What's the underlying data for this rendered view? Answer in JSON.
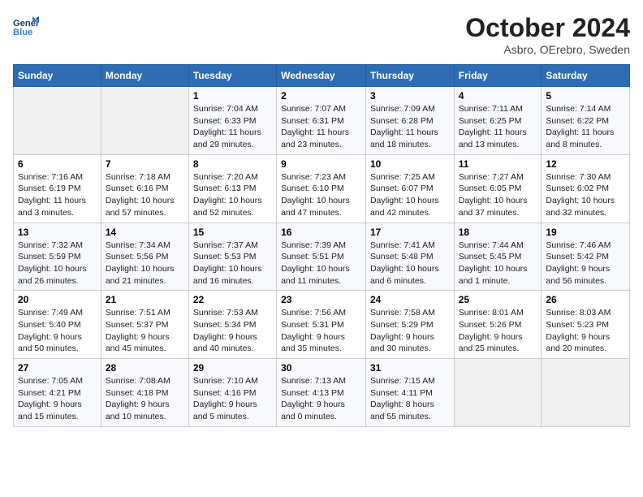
{
  "header": {
    "logo_line1": "General",
    "logo_line2": "Blue",
    "month_title": "October 2024",
    "location": "Asbro, OErebro, Sweden"
  },
  "weekdays": [
    "Sunday",
    "Monday",
    "Tuesday",
    "Wednesday",
    "Thursday",
    "Friday",
    "Saturday"
  ],
  "weeks": [
    [
      {
        "day": "",
        "sunrise": "",
        "sunset": "",
        "daylight": ""
      },
      {
        "day": "",
        "sunrise": "",
        "sunset": "",
        "daylight": ""
      },
      {
        "day": "1",
        "sunrise": "Sunrise: 7:04 AM",
        "sunset": "Sunset: 6:33 PM",
        "daylight": "Daylight: 11 hours and 29 minutes."
      },
      {
        "day": "2",
        "sunrise": "Sunrise: 7:07 AM",
        "sunset": "Sunset: 6:31 PM",
        "daylight": "Daylight: 11 hours and 23 minutes."
      },
      {
        "day": "3",
        "sunrise": "Sunrise: 7:09 AM",
        "sunset": "Sunset: 6:28 PM",
        "daylight": "Daylight: 11 hours and 18 minutes."
      },
      {
        "day": "4",
        "sunrise": "Sunrise: 7:11 AM",
        "sunset": "Sunset: 6:25 PM",
        "daylight": "Daylight: 11 hours and 13 minutes."
      },
      {
        "day": "5",
        "sunrise": "Sunrise: 7:14 AM",
        "sunset": "Sunset: 6:22 PM",
        "daylight": "Daylight: 11 hours and 8 minutes."
      }
    ],
    [
      {
        "day": "6",
        "sunrise": "Sunrise: 7:16 AM",
        "sunset": "Sunset: 6:19 PM",
        "daylight": "Daylight: 11 hours and 3 minutes."
      },
      {
        "day": "7",
        "sunrise": "Sunrise: 7:18 AM",
        "sunset": "Sunset: 6:16 PM",
        "daylight": "Daylight: 10 hours and 57 minutes."
      },
      {
        "day": "8",
        "sunrise": "Sunrise: 7:20 AM",
        "sunset": "Sunset: 6:13 PM",
        "daylight": "Daylight: 10 hours and 52 minutes."
      },
      {
        "day": "9",
        "sunrise": "Sunrise: 7:23 AM",
        "sunset": "Sunset: 6:10 PM",
        "daylight": "Daylight: 10 hours and 47 minutes."
      },
      {
        "day": "10",
        "sunrise": "Sunrise: 7:25 AM",
        "sunset": "Sunset: 6:07 PM",
        "daylight": "Daylight: 10 hours and 42 minutes."
      },
      {
        "day": "11",
        "sunrise": "Sunrise: 7:27 AM",
        "sunset": "Sunset: 6:05 PM",
        "daylight": "Daylight: 10 hours and 37 minutes."
      },
      {
        "day": "12",
        "sunrise": "Sunrise: 7:30 AM",
        "sunset": "Sunset: 6:02 PM",
        "daylight": "Daylight: 10 hours and 32 minutes."
      }
    ],
    [
      {
        "day": "13",
        "sunrise": "Sunrise: 7:32 AM",
        "sunset": "Sunset: 5:59 PM",
        "daylight": "Daylight: 10 hours and 26 minutes."
      },
      {
        "day": "14",
        "sunrise": "Sunrise: 7:34 AM",
        "sunset": "Sunset: 5:56 PM",
        "daylight": "Daylight: 10 hours and 21 minutes."
      },
      {
        "day": "15",
        "sunrise": "Sunrise: 7:37 AM",
        "sunset": "Sunset: 5:53 PM",
        "daylight": "Daylight: 10 hours and 16 minutes."
      },
      {
        "day": "16",
        "sunrise": "Sunrise: 7:39 AM",
        "sunset": "Sunset: 5:51 PM",
        "daylight": "Daylight: 10 hours and 11 minutes."
      },
      {
        "day": "17",
        "sunrise": "Sunrise: 7:41 AM",
        "sunset": "Sunset: 5:48 PM",
        "daylight": "Daylight: 10 hours and 6 minutes."
      },
      {
        "day": "18",
        "sunrise": "Sunrise: 7:44 AM",
        "sunset": "Sunset: 5:45 PM",
        "daylight": "Daylight: 10 hours and 1 minute."
      },
      {
        "day": "19",
        "sunrise": "Sunrise: 7:46 AM",
        "sunset": "Sunset: 5:42 PM",
        "daylight": "Daylight: 9 hours and 56 minutes."
      }
    ],
    [
      {
        "day": "20",
        "sunrise": "Sunrise: 7:49 AM",
        "sunset": "Sunset: 5:40 PM",
        "daylight": "Daylight: 9 hours and 50 minutes."
      },
      {
        "day": "21",
        "sunrise": "Sunrise: 7:51 AM",
        "sunset": "Sunset: 5:37 PM",
        "daylight": "Daylight: 9 hours and 45 minutes."
      },
      {
        "day": "22",
        "sunrise": "Sunrise: 7:53 AM",
        "sunset": "Sunset: 5:34 PM",
        "daylight": "Daylight: 9 hours and 40 minutes."
      },
      {
        "day": "23",
        "sunrise": "Sunrise: 7:56 AM",
        "sunset": "Sunset: 5:31 PM",
        "daylight": "Daylight: 9 hours and 35 minutes."
      },
      {
        "day": "24",
        "sunrise": "Sunrise: 7:58 AM",
        "sunset": "Sunset: 5:29 PM",
        "daylight": "Daylight: 9 hours and 30 minutes."
      },
      {
        "day": "25",
        "sunrise": "Sunrise: 8:01 AM",
        "sunset": "Sunset: 5:26 PM",
        "daylight": "Daylight: 9 hours and 25 minutes."
      },
      {
        "day": "26",
        "sunrise": "Sunrise: 8:03 AM",
        "sunset": "Sunset: 5:23 PM",
        "daylight": "Daylight: 9 hours and 20 minutes."
      }
    ],
    [
      {
        "day": "27",
        "sunrise": "Sunrise: 7:05 AM",
        "sunset": "Sunset: 4:21 PM",
        "daylight": "Daylight: 9 hours and 15 minutes."
      },
      {
        "day": "28",
        "sunrise": "Sunrise: 7:08 AM",
        "sunset": "Sunset: 4:18 PM",
        "daylight": "Daylight: 9 hours and 10 minutes."
      },
      {
        "day": "29",
        "sunrise": "Sunrise: 7:10 AM",
        "sunset": "Sunset: 4:16 PM",
        "daylight": "Daylight: 9 hours and 5 minutes."
      },
      {
        "day": "30",
        "sunrise": "Sunrise: 7:13 AM",
        "sunset": "Sunset: 4:13 PM",
        "daylight": "Daylight: 9 hours and 0 minutes."
      },
      {
        "day": "31",
        "sunrise": "Sunrise: 7:15 AM",
        "sunset": "Sunset: 4:11 PM",
        "daylight": "Daylight: 8 hours and 55 minutes."
      },
      {
        "day": "",
        "sunrise": "",
        "sunset": "",
        "daylight": ""
      },
      {
        "day": "",
        "sunrise": "",
        "sunset": "",
        "daylight": ""
      }
    ]
  ]
}
